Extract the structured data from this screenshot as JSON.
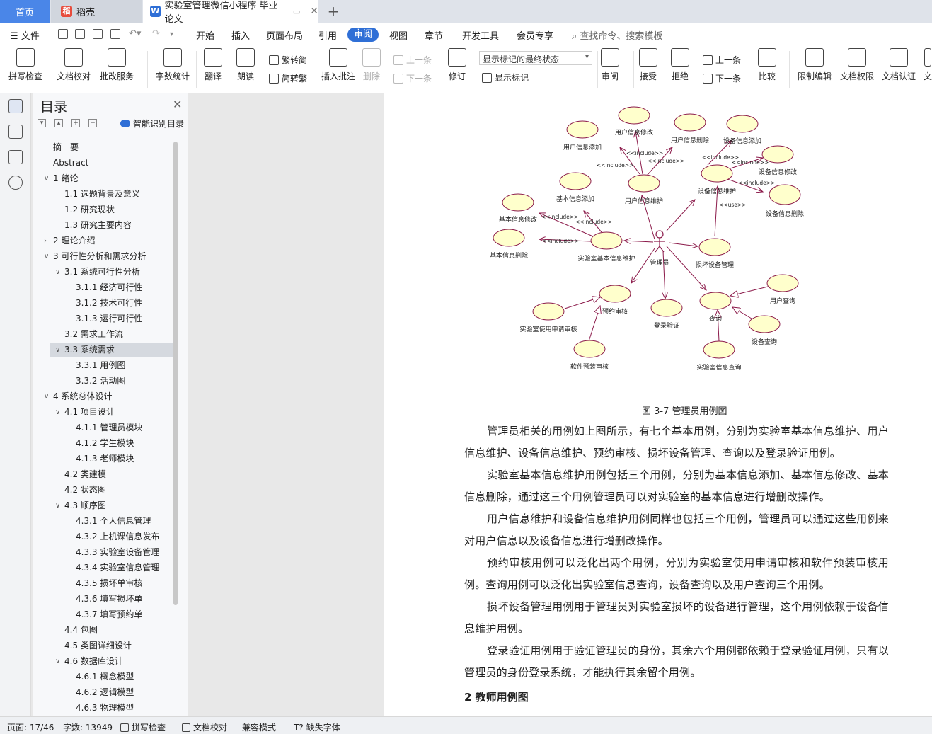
{
  "tabs": {
    "home": "首页",
    "shell": "稻壳",
    "doc": "实验室管理微信小程序 毕业论文"
  },
  "menu": {
    "file": "文件",
    "items": [
      "开始",
      "插入",
      "页面布局",
      "引用",
      "审阅",
      "视图",
      "章节",
      "开发工具",
      "会员专享"
    ],
    "active": "审阅",
    "search": "查找命令、搜索模板"
  },
  "ribbon": {
    "spell": "拼写检查",
    "proof": "文档校对",
    "review_service": "批改服务",
    "word_count": "字数统计",
    "translate": "翻译",
    "read": "朗读",
    "trad": "繁转简",
    "simp": "简转繁",
    "insert_comment": "插入批注",
    "delete": "删除",
    "prev": "上一条",
    "next": "下一条",
    "revise": "修订",
    "markup_state": "显示标记的最终状态",
    "show_markup": "显示标记",
    "review": "审阅",
    "accept": "接受",
    "reject": "拒绝",
    "prev2": "上一条",
    "next2": "下一条",
    "compare": "比较",
    "restrict": "限制编辑",
    "permission": "文档权限",
    "cert": "文档认证",
    "more": "文"
  },
  "outline": {
    "title": "目录",
    "smart": "智能识别目录",
    "items": [
      {
        "label": "摘　要",
        "level": 0,
        "arrow": ""
      },
      {
        "label": "Abstract",
        "level": 0,
        "arrow": ""
      },
      {
        "label": "1 绪论",
        "level": 0,
        "arrow": "v"
      },
      {
        "label": "1.1 选题背景及意义",
        "level": 1,
        "arrow": ""
      },
      {
        "label": "1.2 研究现状",
        "level": 1,
        "arrow": ""
      },
      {
        "label": "1.3 研究主要内容",
        "level": 1,
        "arrow": ""
      },
      {
        "label": "2 理论介绍",
        "level": 0,
        "arrow": ">"
      },
      {
        "label": "3 可行性分析和需求分析",
        "level": 0,
        "arrow": "v"
      },
      {
        "label": "3.1 系统可行性分析",
        "level": 1,
        "arrow": "v"
      },
      {
        "label": "3.1.1 经济可行性",
        "level": 2,
        "arrow": ""
      },
      {
        "label": "3.1.2 技术可行性",
        "level": 2,
        "arrow": ""
      },
      {
        "label": "3.1.3 运行可行性",
        "level": 2,
        "arrow": ""
      },
      {
        "label": "3.2 需求工作流",
        "level": 1,
        "arrow": ""
      },
      {
        "label": "3.3 系统需求",
        "level": 1,
        "arrow": "v",
        "selected": true
      },
      {
        "label": "3.3.1 用例图",
        "level": 2,
        "arrow": ""
      },
      {
        "label": "3.3.2 活动图",
        "level": 2,
        "arrow": ""
      },
      {
        "label": "4 系统总体设计",
        "level": 0,
        "arrow": "v"
      },
      {
        "label": "4.1 项目设计",
        "level": 1,
        "arrow": "v"
      },
      {
        "label": "4.1.1 管理员模块",
        "level": 2,
        "arrow": ""
      },
      {
        "label": "4.1.2 学生模块",
        "level": 2,
        "arrow": ""
      },
      {
        "label": "4.1.3 老师模块",
        "level": 2,
        "arrow": ""
      },
      {
        "label": "4.2 类建模",
        "level": 1,
        "arrow": ""
      },
      {
        "label": "4.2  状态图",
        "level": 1,
        "arrow": ""
      },
      {
        "label": "4.3  顺序图",
        "level": 1,
        "arrow": "v"
      },
      {
        "label": "4.3.1 个人信息管理",
        "level": 2,
        "arrow": ""
      },
      {
        "label": "4.3.2 上机课信息发布",
        "level": 2,
        "arrow": ""
      },
      {
        "label": "4.3.3 实验室设备管理",
        "level": 2,
        "arrow": ""
      },
      {
        "label": "4.3.4 实验室信息管理",
        "level": 2,
        "arrow": ""
      },
      {
        "label": "4.3.5 损坏单审核",
        "level": 2,
        "arrow": ""
      },
      {
        "label": "4.3.6 填写损坏单",
        "level": 2,
        "arrow": ""
      },
      {
        "label": "4.3.7 填写预约单",
        "level": 2,
        "arrow": ""
      },
      {
        "label": "4.4  包图",
        "level": 1,
        "arrow": ""
      },
      {
        "label": "4.5 类图详细设计",
        "level": 1,
        "arrow": ""
      },
      {
        "label": "4.6  数据库设计",
        "level": 1,
        "arrow": "v"
      },
      {
        "label": "4.6.1  概念模型",
        "level": 2,
        "arrow": ""
      },
      {
        "label": "4.6.2  逻辑模型",
        "level": 2,
        "arrow": ""
      },
      {
        "label": "4.6.3  物理模型",
        "level": 2,
        "arrow": ""
      }
    ]
  },
  "diagram": {
    "actor": "管理员",
    "nodes": {
      "user_add": "用户信息添加",
      "user_mod": "用户信息修改",
      "user_del": "用户信息删除",
      "dev_add": "设备信息添加",
      "dev_mod": "设备信息修改",
      "dev_del": "设备信息删除",
      "basic_add": "基本信息添加",
      "basic_mod": "基本信息修改",
      "basic_del": "基本信息删除",
      "user_maint": "用户信息维护",
      "dev_maint": "设备信息维护",
      "lab_basic": "实验室基本信息维护",
      "broken": "损坏设备管理",
      "reserve": "预约审核",
      "login": "登录验证",
      "query": "查询",
      "user_query": "用户查询",
      "dev_query": "设备查询",
      "lab_query": "实验室信息查询",
      "lab_apply": "实验室使用申请审核",
      "soft_apply": "软件预装审核"
    },
    "include": "<<include>>",
    "use": "<<use>>"
  },
  "caption": "图 3-7  管理员用例图",
  "paragraphs": [
    "管理员相关的用例如上图所示，有七个基本用例，分别为实验室基本信息维护、用户信息维护、设备信息维护、预约审核、损坏设备管理、查询以及登录验证用例。",
    "实验室基本信息维护用例包括三个用例，分别为基本信息添加、基本信息修改、基本信息删除，通过这三个用例管理员可以对实验室的基本信息进行增删改操作。",
    "用户信息维护和设备信息维护用例同样也包括三个用例，管理员可以通过这些用例来对用户信息以及设备信息进行增删改操作。",
    "预约审核用例可以泛化出两个用例，分别为实验室使用申请审核和软件预装审核用例。查询用例可以泛化出实验室信息查询，设备查询以及用户查询三个用例。",
    "损坏设备管理用例用于管理员对实验室损坏的设备进行管理，这个用例依赖于设备信息维护用例。",
    "登录验证用例用于验证管理员的身份，其余六个用例都依赖于登录验证用例，只有以管理员的身份登录系统，才能执行其余留个用例。"
  ],
  "heading": "2  教师用例图",
  "status": {
    "page": "页面: 17/46",
    "words": "字数: 13949",
    "spell": "拼写检查",
    "proof": "文档校对",
    "compat": "兼容模式",
    "missing_font": "缺失字体"
  }
}
